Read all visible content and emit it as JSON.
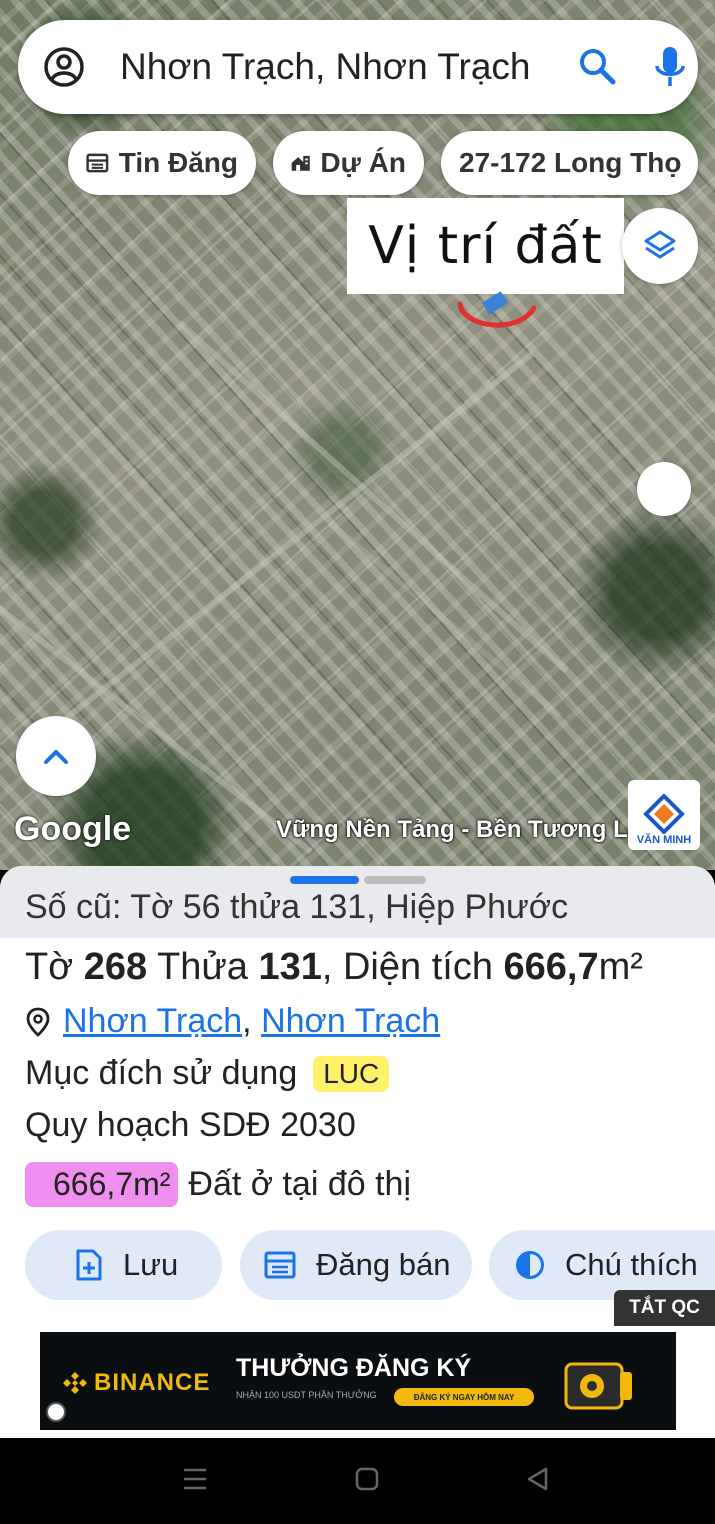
{
  "search": {
    "query": "Nhơn Trạch, Nhơn Trạch",
    "icons": [
      "account-circle-icon",
      "search-icon",
      "mic-icon"
    ]
  },
  "chips": [
    {
      "label": "Tin Đăng",
      "icon": "calendar-list-icon"
    },
    {
      "label": "Dự Án",
      "icon": "house-building-icon"
    },
    {
      "label": "27-172 Long Thọ",
      "icon": ""
    }
  ],
  "map": {
    "pin_label": "Vị trí đất",
    "google_logo": "Google",
    "street_label": "Vững Nền Tảng - Bền Tương Lai",
    "brand_name": "VĂN MINH",
    "accent_marker": "#e03030"
  },
  "parcel": {
    "old_info": "Số cũ: Tờ 56 thửa 131, Hiệp Phước",
    "sheet_label": "Tờ",
    "sheet_number": "268",
    "plot_label": "Thửa",
    "plot_number": "131",
    "area_label": ", Diện tích",
    "area_value": "666,7",
    "area_unit": "m²",
    "address_district": "Nhơn Trạch",
    "address_separator": ",",
    "address_commune": "Nhơn Trạch",
    "purpose_label": "Mục đích sử dụng",
    "purpose_code": "LUC",
    "plan_label": "Quy hoạch SDĐ 2030",
    "zone_area": "666,7m²",
    "zone_name": "Đất ở tại đô thị",
    "zone_color": "#ef8fef"
  },
  "actions": {
    "save": "Lưu",
    "post_sale": "Đăng bán",
    "legend": "Chú thích"
  },
  "ad": {
    "hide_label": "TẮT QC",
    "brand": "BINANCE",
    "headline": "THƯỞNG ĐĂNG KÝ",
    "subline": "NHẬN 100 USDT PHẦN THƯỞNG",
    "cta": "ĐĂNG KÝ NGAY HÔM NAY"
  },
  "colors": {
    "accent": "#1a73e8",
    "badge_yellow": "#fff26a",
    "action_bg": "#dfe9f7"
  }
}
